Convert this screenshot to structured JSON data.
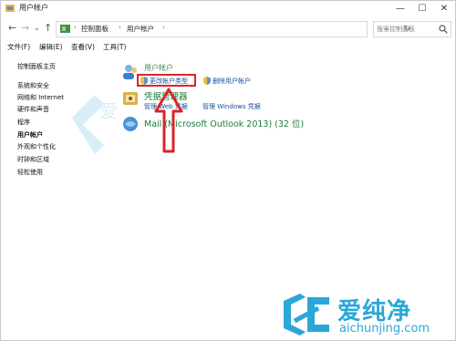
{
  "window": {
    "title": "用户帐户",
    "controls": [
      "—",
      "☐",
      "✕"
    ]
  },
  "address": {
    "crumbs": [
      "控制面板",
      "用户帐户"
    ],
    "search_placeholder": "搜索控制面板"
  },
  "menu": [
    "文件(F)",
    "编辑(E)",
    "查看(V)",
    "工具(T)"
  ],
  "sidebar": {
    "items": [
      {
        "label": "控制面板主页",
        "active": false
      },
      {
        "label": "系统和安全",
        "active": false
      },
      {
        "label": "网络和 Internet",
        "active": false
      },
      {
        "label": "硬件和声音",
        "active": false
      },
      {
        "label": "程序",
        "active": false
      },
      {
        "label": "用户帐户",
        "active": true
      },
      {
        "label": "外观和个性化",
        "active": false
      },
      {
        "label": "时钟和区域",
        "active": false
      },
      {
        "label": "轻松使用",
        "active": false
      }
    ]
  },
  "sections": {
    "user_accounts": {
      "title": "用户帐户",
      "link_change_type": "更改帐户类型",
      "link_remove": "删除用户帐户"
    },
    "credential_manager": {
      "title": "凭据管理器",
      "link_web": "管理 Web 凭据",
      "link_windows": "管理 Windows 凭据"
    },
    "mail": {
      "title": "Mail (Microsoft Outlook 2013) (32 位)"
    }
  },
  "annotation": {
    "highlight_color": "#d8252b"
  },
  "watermark": {
    "brand": "爱纯净",
    "url": "aichunjing.com",
    "color": "#2aa7d8"
  }
}
